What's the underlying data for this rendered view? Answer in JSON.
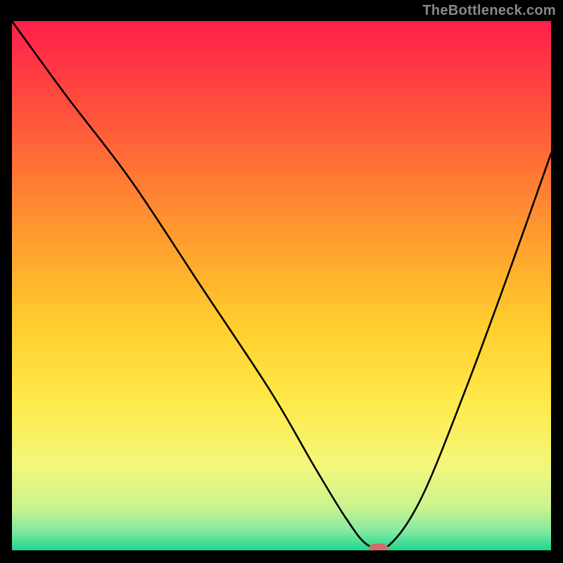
{
  "watermark": "TheBottleneck.com",
  "chart_data": {
    "type": "line",
    "title": "",
    "xlabel": "",
    "ylabel": "",
    "x_range": [
      0,
      100
    ],
    "y_range": [
      0,
      100
    ],
    "curve": {
      "name": "bottleneck-curve",
      "color": "#000000",
      "x": [
        0,
        10,
        22,
        35,
        48,
        56,
        62,
        66,
        70,
        76,
        84,
        92,
        100
      ],
      "y": [
        100,
        86,
        70,
        50,
        30,
        16,
        6,
        1,
        1,
        10,
        30,
        52,
        75
      ]
    },
    "marker": {
      "name": "optimal-marker",
      "x_pct": 68,
      "y_pct": 0.5,
      "color": "#d46a6a",
      "rx": 14,
      "ry": 6
    },
    "background_gradient": {
      "stops": [
        {
          "offset": 0.0,
          "color": "#ff1f4b"
        },
        {
          "offset": 0.2,
          "color": "#ff5a3a"
        },
        {
          "offset": 0.4,
          "color": "#ff9a2e"
        },
        {
          "offset": 0.58,
          "color": "#ffcf2e"
        },
        {
          "offset": 0.72,
          "color": "#ffe94a"
        },
        {
          "offset": 0.84,
          "color": "#f2f77a"
        },
        {
          "offset": 0.92,
          "color": "#c9f38f"
        },
        {
          "offset": 0.965,
          "color": "#7fe9a0"
        },
        {
          "offset": 1.0,
          "color": "#1fd58c"
        }
      ]
    }
  }
}
